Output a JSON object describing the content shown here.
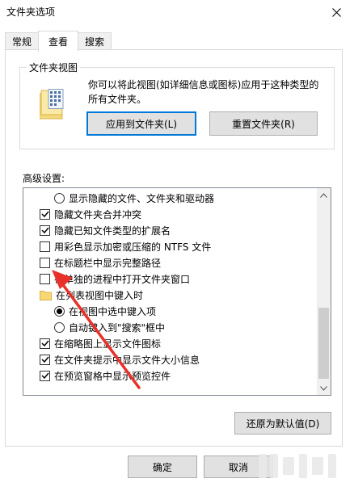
{
  "window": {
    "title": "文件夹选项"
  },
  "tabs": [
    {
      "label": "常规"
    },
    {
      "label": "查看"
    },
    {
      "label": "搜索"
    }
  ],
  "folder_views": {
    "title": "文件夹视图",
    "description": "你可以将此视图(如详细信息或图标)应用于这种类型的所有文件夹。",
    "apply_button": "应用到文件夹(L)",
    "reset_button": "重置文件夹(R)"
  },
  "advanced": {
    "label": "高级设置:",
    "items": [
      {
        "type": "radio",
        "checked": false,
        "label": "显示隐藏的文件、文件夹和驱动器"
      },
      {
        "type": "checkbox",
        "checked": true,
        "label": "隐藏文件夹合并冲突"
      },
      {
        "type": "checkbox",
        "checked": true,
        "label": "隐藏已知文件类型的扩展名"
      },
      {
        "type": "checkbox",
        "checked": false,
        "label": "用彩色显示加密或压缩的 NTFS 文件"
      },
      {
        "type": "checkbox",
        "checked": false,
        "label": "在标题栏中显示完整路径"
      },
      {
        "type": "checkbox",
        "checked": false,
        "label": "在单独的进程中打开文件夹窗口"
      },
      {
        "type": "folder",
        "label": "在列表视图中键入时"
      },
      {
        "type": "radio",
        "checked": true,
        "label": "在视图中选中键入项"
      },
      {
        "type": "radio",
        "checked": false,
        "label": "自动键入到\"搜索\"框中"
      },
      {
        "type": "checkbox",
        "checked": true,
        "label": "在缩略图上显示文件图标"
      },
      {
        "type": "checkbox",
        "checked": true,
        "label": "在文件夹提示中显示文件大小信息"
      },
      {
        "type": "checkbox",
        "checked": true,
        "label": "在预览窗格中显示预览控件"
      }
    ]
  },
  "restore_button": "还原为默认值(D)",
  "footer": {
    "ok": "确定",
    "cancel": "取消"
  },
  "colors": {
    "accent": "#0078d7",
    "annotation_arrow": "#e8312a"
  }
}
